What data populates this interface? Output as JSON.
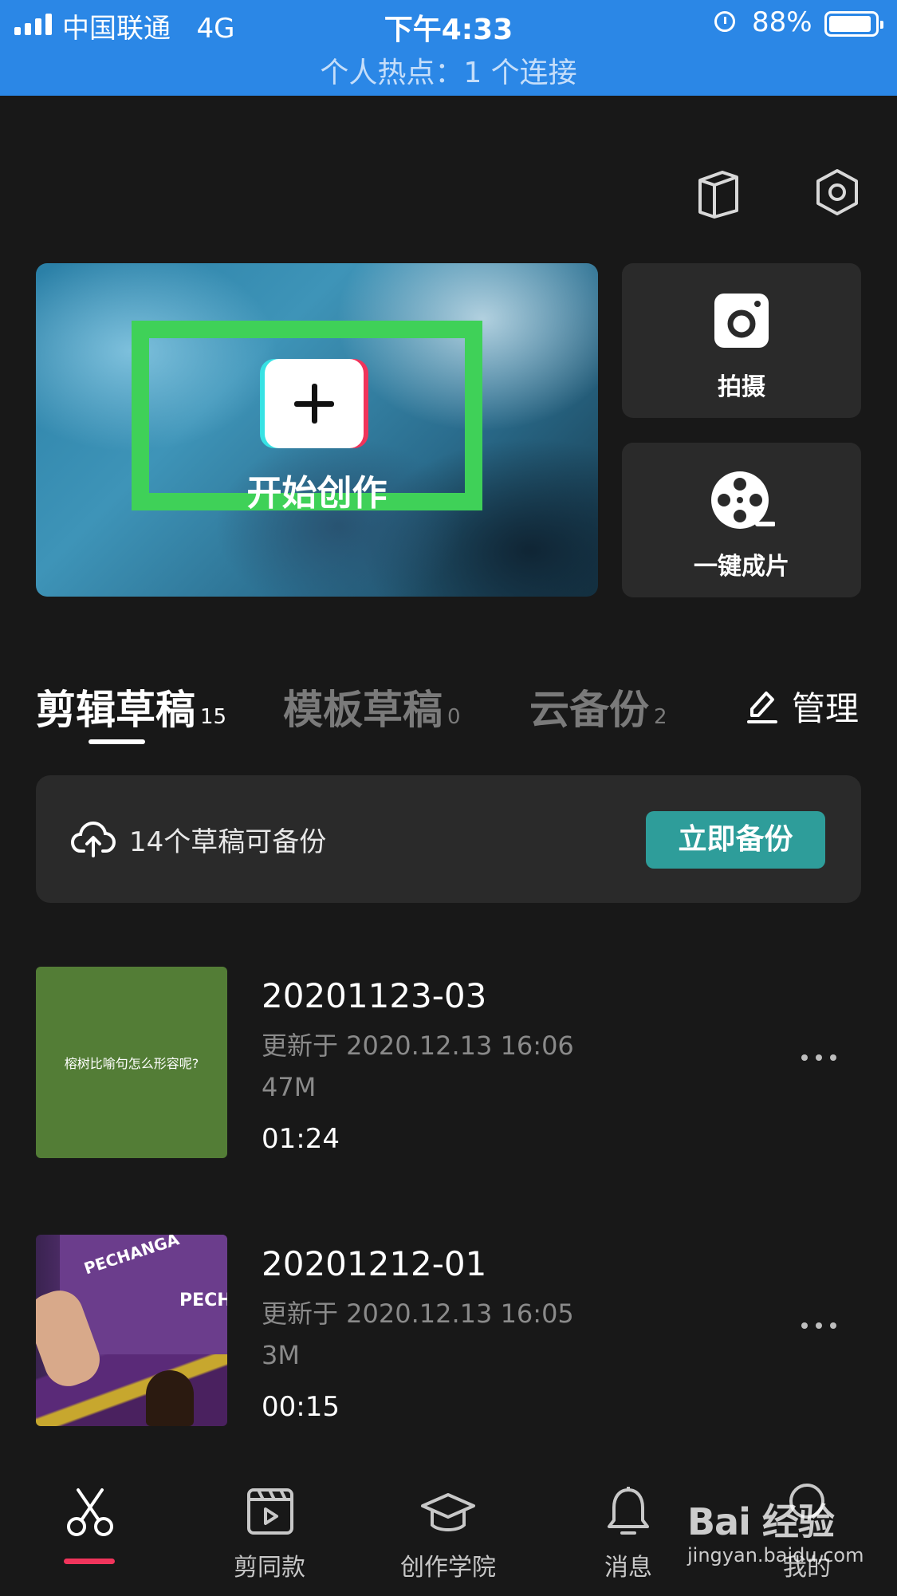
{
  "status_bar": {
    "carrier": "中国联通",
    "network": "4G",
    "time": "下午4:33",
    "battery_percent": "88%",
    "hotspot": "个人热点：1 个连接"
  },
  "hero": {
    "label": "开始创作",
    "frame_color": "#3fd158"
  },
  "side_actions": {
    "shoot_label": "拍摄",
    "one_click_label": "一键成片"
  },
  "tabs": [
    {
      "label": "剪辑草稿",
      "count": "15",
      "active": true
    },
    {
      "label": "模板草稿",
      "count": "0",
      "active": false
    },
    {
      "label": "云备份",
      "count": "2",
      "active": false
    }
  ],
  "manage_label": "管理",
  "backup_banner": {
    "text": "14个草稿可备份",
    "button_label": "立即备份",
    "button_color": "#2e9d9a"
  },
  "drafts": [
    {
      "title": "20201123-03",
      "updated": "更新于 2020.12.13 16:06",
      "size": "47M",
      "duration": "01:24",
      "thumb_caption": "榕树比喻句怎么形容呢?"
    },
    {
      "title": "20201212-01",
      "updated": "更新于 2020.12.13 16:05",
      "size": "3M",
      "duration": "00:15",
      "thumb_text_1": "PECHANGA",
      "thumb_text_2": "PECHA"
    }
  ],
  "nav": [
    {
      "label": "",
      "icon": "scissors-icon",
      "active": true
    },
    {
      "label": "剪同款",
      "icon": "clapper-icon"
    },
    {
      "label": "创作学院",
      "icon": "graduation-cap-icon"
    },
    {
      "label": "消息",
      "icon": "bell-icon"
    },
    {
      "label": "我的",
      "icon": "profile-icon"
    }
  ],
  "watermark": {
    "line1": "Bai 经验",
    "line2": "jingyan.baidu.com"
  },
  "accent_color": "#f0345b"
}
